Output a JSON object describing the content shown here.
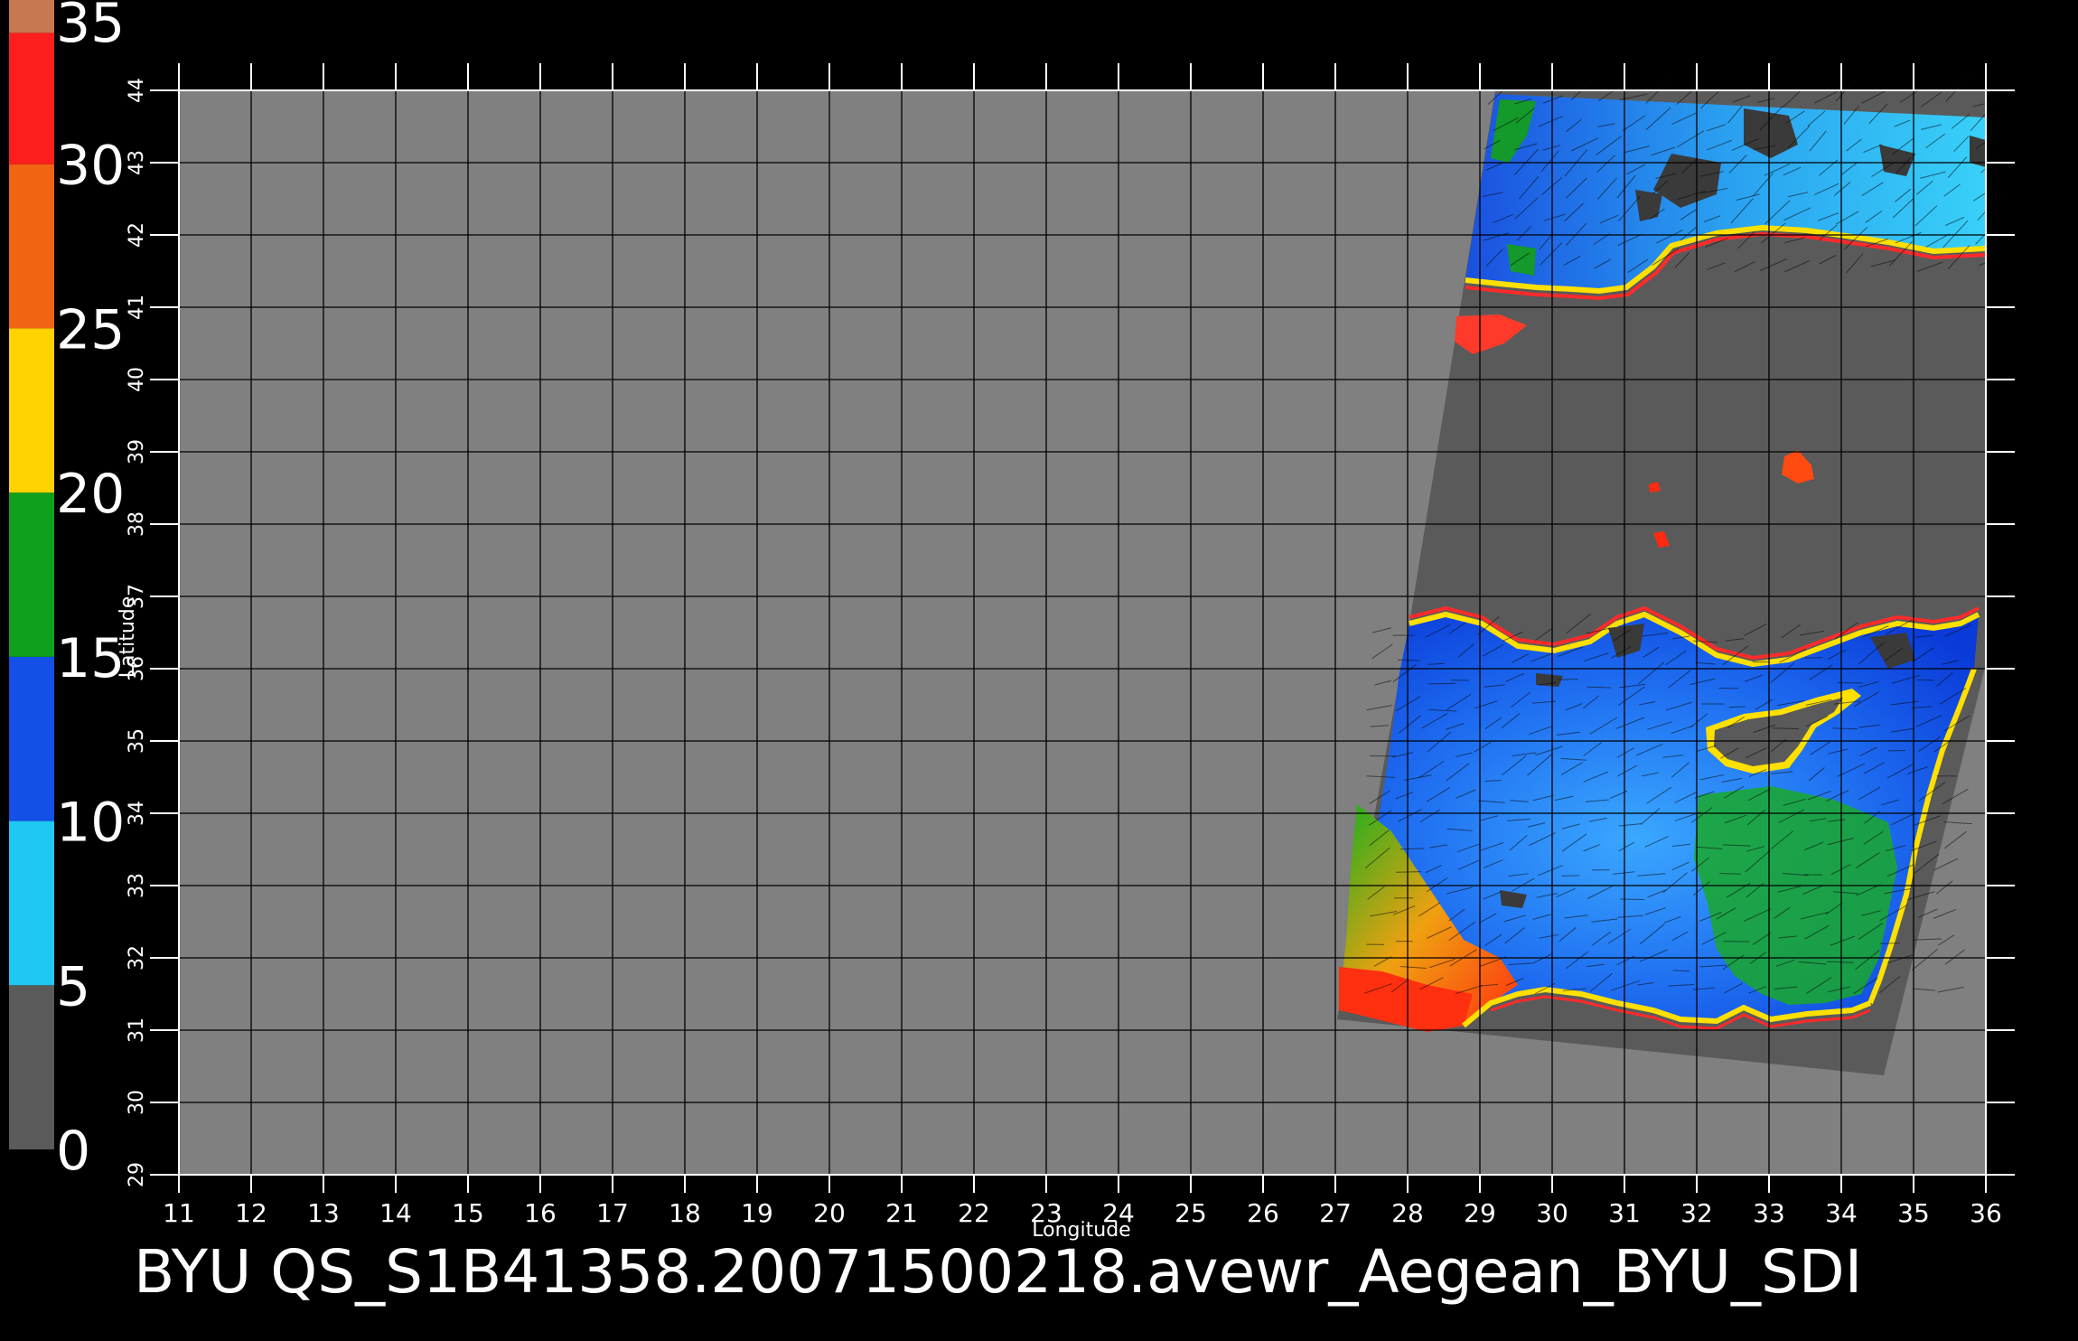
{
  "title": "BYU  QS_S1B41358.20071500218.avewr_Aegean_BYU_SDI",
  "axes": {
    "xlabel": "Longitude",
    "ylabel": "Latitude",
    "x_ticks": [
      "11",
      "12",
      "13",
      "14",
      "15",
      "16",
      "17",
      "18",
      "19",
      "20",
      "21",
      "22",
      "23",
      "24",
      "25",
      "26",
      "27",
      "28",
      "29",
      "30",
      "31",
      "32",
      "33",
      "34",
      "35",
      "36"
    ],
    "y_ticks": [
      "29",
      "30",
      "31",
      "32",
      "33",
      "34",
      "35",
      "36",
      "37",
      "38",
      "39",
      "40",
      "41",
      "42",
      "43",
      "44"
    ],
    "xlim": [
      11,
      36
    ],
    "ylim": [
      29,
      44
    ]
  },
  "colorbar": {
    "ticks": [
      "35",
      "30",
      "25",
      "20",
      "15",
      "10",
      "5",
      "0"
    ],
    "range": [
      0,
      35
    ],
    "stops": [
      {
        "from": 0,
        "to": 5,
        "color": "#5a5a5a"
      },
      {
        "from": 5,
        "to": 10,
        "color": "#1ec8f0"
      },
      {
        "from": 10,
        "to": 15,
        "color": "#1450e6"
      },
      {
        "from": 15,
        "to": 20,
        "color": "#0fa01e"
      },
      {
        "from": 20,
        "to": 25,
        "color": "#ffd200"
      },
      {
        "from": 25,
        "to": 30,
        "color": "#f06414"
      },
      {
        "from": 30,
        "to": 34,
        "color": "#ff1e1e"
      },
      {
        "from": 34,
        "to": 35,
        "color": "#c87850"
      }
    ]
  },
  "colors": {
    "background": "#000000",
    "land_fill": "#808080",
    "swath_fill": "#5a5a5a",
    "grid": "#000000",
    "text": "#ffffff"
  }
}
